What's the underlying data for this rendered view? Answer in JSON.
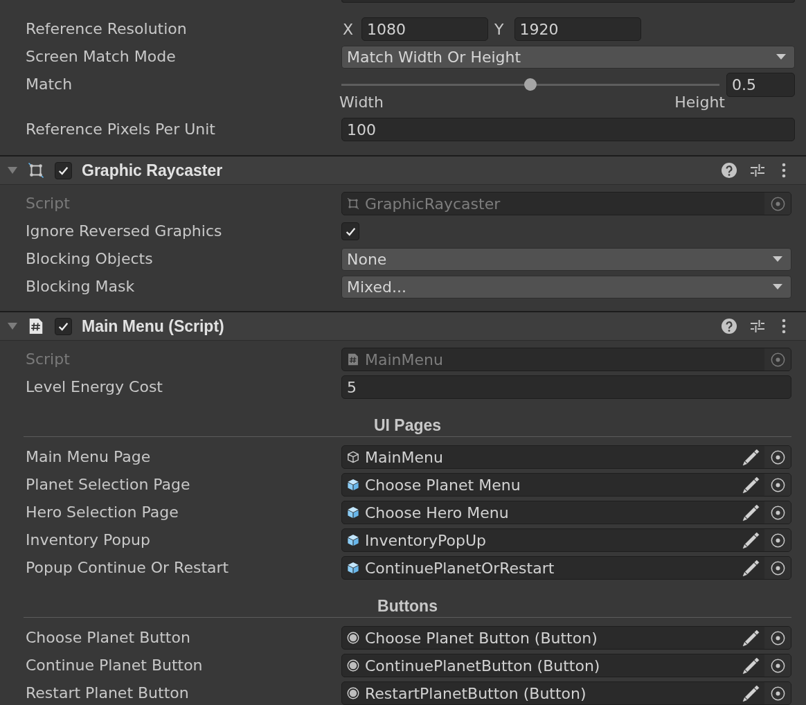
{
  "canvas_scaler": {
    "properties": [
      {
        "kind": "vector2",
        "label": "Reference Resolution",
        "disabled": false,
        "fields": [
          {
            "axis": "X",
            "value": "1080"
          },
          {
            "axis": "Y",
            "value": "1920"
          }
        ]
      },
      {
        "kind": "dropdown",
        "label": "Screen Match Mode",
        "disabled": false,
        "value": "Match Width Or Height"
      },
      {
        "kind": "slider",
        "label": "Match",
        "disabled": false,
        "level": 0.5,
        "value": "0.5",
        "min_label": "Width",
        "max_label": "Height"
      },
      {
        "kind": "number",
        "label": "Reference Pixels Per Unit",
        "disabled": false,
        "value": "100"
      }
    ]
  },
  "components": [
    {
      "kind": "builtin",
      "title": "Graphic Raycaster",
      "enabled": true,
      "expanded": true,
      "properties": [
        {
          "kind": "script",
          "label": "Script",
          "disabled": true,
          "value": "GraphicRaycaster"
        },
        {
          "kind": "checkbox",
          "label": "Ignore Reversed Graphics",
          "disabled": false,
          "checked": true
        },
        {
          "kind": "dropdown",
          "label": "Blocking Objects",
          "disabled": false,
          "value": "None"
        },
        {
          "kind": "dropdown",
          "label": "Blocking Mask",
          "disabled": false,
          "value": "Mixed..."
        }
      ]
    },
    {
      "kind": "script",
      "title": "Main Menu (Script)",
      "enabled": true,
      "expanded": true,
      "properties": [
        {
          "kind": "script",
          "label": "Script",
          "disabled": true,
          "value": "MainMenu"
        },
        {
          "kind": "number",
          "label": "Level Energy Cost",
          "disabled": false,
          "value": "5"
        },
        {
          "kind": "heading",
          "text": "UI Pages"
        },
        {
          "kind": "gameobject",
          "label": "Main Menu Page",
          "disabled": false,
          "value": "MainMenu"
        },
        {
          "kind": "prefab",
          "label": "Planet Selection Page",
          "disabled": false,
          "value": "Choose Planet Menu"
        },
        {
          "kind": "prefab",
          "label": "Hero Selection Page",
          "disabled": false,
          "value": "Choose Hero Menu"
        },
        {
          "kind": "prefab",
          "label": "Inventory Popup",
          "disabled": false,
          "value": "InventoryPopUp"
        },
        {
          "kind": "prefab",
          "label": "Popup Continue Or Restart",
          "disabled": false,
          "value": "ContinuePlanetOrRestart"
        },
        {
          "kind": "heading",
          "text": "Buttons"
        },
        {
          "kind": "component",
          "label": "Choose Planet Button",
          "disabled": false,
          "value": "Choose Planet Button (Button)"
        },
        {
          "kind": "component",
          "label": "Continue Planet Button",
          "disabled": false,
          "value": "ContinuePlanetButton (Button)"
        },
        {
          "kind": "component",
          "label": "Restart Planet Button",
          "disabled": false,
          "value": "RestartPlanetButton (Button)"
        }
      ]
    }
  ]
}
